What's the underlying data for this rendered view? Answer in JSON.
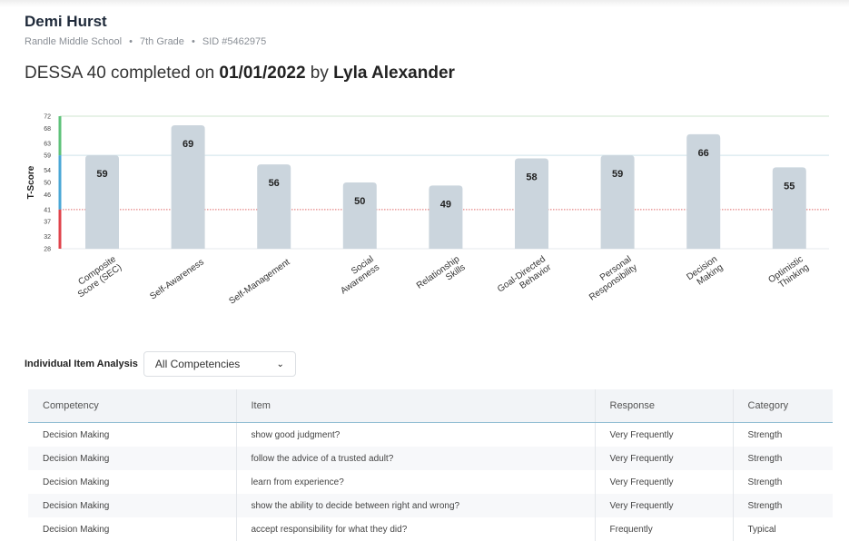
{
  "student": {
    "name": "Demi Hurst",
    "school": "Randle Middle School",
    "grade": "7th Grade",
    "sid": "SID #5462975",
    "separator": "•"
  },
  "assessment": {
    "prefix": "DESSA 40 completed on",
    "date": "01/01/2022",
    "by": "by",
    "rater": "Lyla Alexander"
  },
  "chart_data": {
    "type": "bar",
    "ylabel": "T-Score",
    "yticks": [
      28,
      32,
      37,
      41,
      46,
      50,
      54,
      59,
      63,
      68,
      72
    ],
    "ylim": [
      28,
      72
    ],
    "categories": [
      [
        "Composite",
        "Score (SEC)"
      ],
      [
        "Self-Awareness"
      ],
      [
        "Self-Management"
      ],
      [
        "Social",
        "Awareness"
      ],
      [
        "Relationship",
        "Skills"
      ],
      [
        "Goal-Directed",
        "Behavior"
      ],
      [
        "Personal",
        "Responsibility"
      ],
      [
        "Decision",
        "Making"
      ],
      [
        "Optimistic",
        "Thinking"
      ]
    ],
    "values": [
      59,
      69,
      56,
      50,
      49,
      58,
      59,
      66,
      55
    ],
    "reference_lines": [
      {
        "value": 72,
        "color": "#cfe6cf",
        "style": "solid"
      },
      {
        "value": 59,
        "color": "#cfe3ea",
        "style": "solid"
      },
      {
        "value": 41,
        "color": "#e06a6a",
        "style": "dotted"
      }
    ],
    "bands": [
      {
        "from": 59,
        "to": 72,
        "color": "#5ec27a"
      },
      {
        "from": 41,
        "to": 59,
        "color": "#4aa7d6"
      },
      {
        "from": 28,
        "to": 41,
        "color": "#e0434b"
      }
    ],
    "bar_color": "#cbd5dd",
    "grid": false
  },
  "item_analysis": {
    "label": "Individual Item Analysis",
    "select_value": "All Competencies",
    "chevron": "⌄"
  },
  "table": {
    "headers": [
      "Competency",
      "Item",
      "Response",
      "Category"
    ],
    "rows": [
      [
        "Decision Making",
        "show good judgment?",
        "Very Frequently",
        "Strength"
      ],
      [
        "Decision Making",
        "follow the advice of a trusted adult?",
        "Very Frequently",
        "Strength"
      ],
      [
        "Decision Making",
        "learn from experience?",
        "Very Frequently",
        "Strength"
      ],
      [
        "Decision Making",
        "show the ability to decide between right and wrong?",
        "Very Frequently",
        "Strength"
      ],
      [
        "Decision Making",
        "accept responsibility for what they did?",
        "Frequently",
        "Typical"
      ]
    ]
  }
}
